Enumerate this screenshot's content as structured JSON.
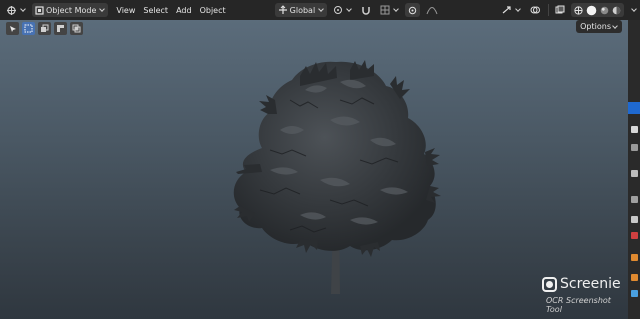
{
  "header": {
    "mode_label": "Object Mode",
    "menus": [
      "View",
      "Select",
      "Add",
      "Object"
    ],
    "orientation_label": "Global",
    "options_label": "Options"
  },
  "watermark": {
    "title": "Screenie",
    "subtitle": "OCR Screenshot Tool"
  },
  "colors": {
    "accent": "#4772b3",
    "header_bg": "#262626",
    "viewport_top": "#5b6c7b",
    "viewport_bottom": "#2f373f"
  }
}
